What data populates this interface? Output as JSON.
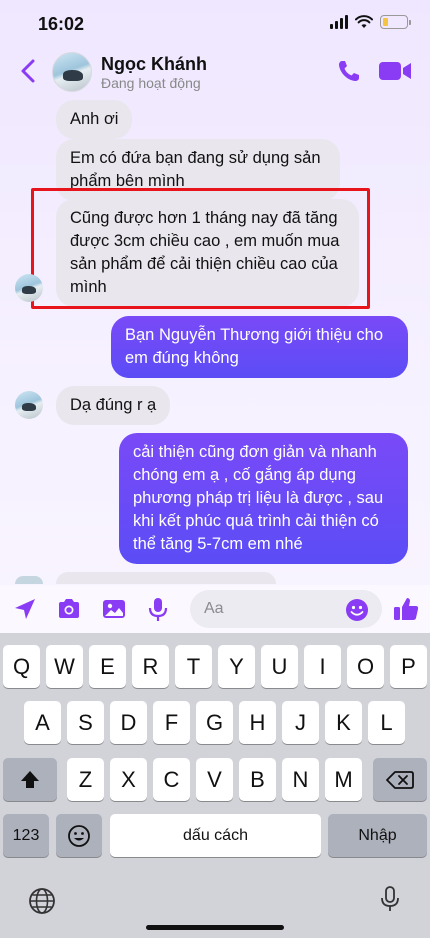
{
  "status_bar": {
    "time": "16:02",
    "battery_percent": 22,
    "battery_color": "#f5c542"
  },
  "header": {
    "contact_name": "Ngọc Khánh",
    "contact_status": "Đang hoạt động",
    "accent_color": "#8a3cf5",
    "icons": [
      "back-chevron-icon",
      "phone-icon",
      "video-camera-icon"
    ]
  },
  "messages": [
    {
      "direction": "in",
      "text": "Anh ơi"
    },
    {
      "direction": "in",
      "text": "Em có đứa bạn đang sử dụng sản phẩm bên mình"
    },
    {
      "direction": "in",
      "text": "Cũng được hơn 1 tháng nay đã tăng được 3cm chiều cao , em muốn mua sản phẩm để cải thiện chiều cao của mình",
      "highlighted": true
    },
    {
      "direction": "out",
      "text": "Bạn Nguyễn Thương giới thiệu cho em đúng không"
    },
    {
      "direction": "in",
      "text": "Dạ đúng r ạ"
    },
    {
      "direction": "out",
      "text": "cải thiện cũng đơn giản và nhanh chóng em ạ , cố gắng áp dụng phương pháp trị liệu là được , sau khi kết phúc quá trình cải thiện có thể tăng 5-7cm em nhé"
    }
  ],
  "highlight_color": "#e8141b",
  "composer": {
    "placeholder": "Aa",
    "icons": [
      "location-arrow-icon",
      "camera-icon",
      "image-icon",
      "microphone-icon",
      "emoji-icon",
      "like-icon"
    ]
  },
  "keyboard": {
    "row1": [
      "Q",
      "W",
      "E",
      "R",
      "T",
      "Y",
      "U",
      "I",
      "O",
      "P"
    ],
    "row2": [
      "A",
      "S",
      "D",
      "F",
      "G",
      "H",
      "J",
      "K",
      "L"
    ],
    "row3": [
      "Z",
      "X",
      "C",
      "V",
      "B",
      "N",
      "M"
    ],
    "numbers_key": "123",
    "space_key": "dấu cách",
    "return_key": "Nhập",
    "icons": [
      "shift-icon",
      "backspace-icon",
      "emoji-key-icon",
      "globe-icon",
      "dictation-icon"
    ]
  }
}
